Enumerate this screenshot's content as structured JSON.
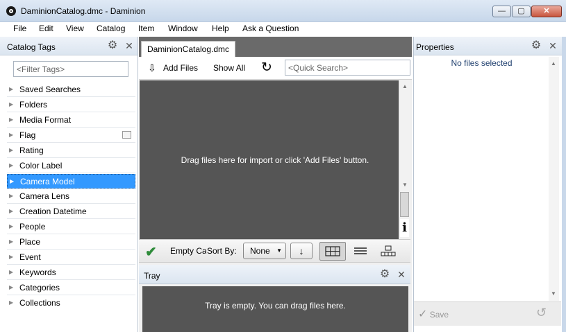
{
  "window": {
    "title": "DaminionCatalog.dmc - Daminion",
    "min_label": "—",
    "max_label": "▢",
    "close_label": "✕"
  },
  "menu": [
    "File",
    "Edit",
    "View",
    "Catalog",
    "Item",
    "Window",
    "Help",
    "Ask a Question"
  ],
  "catalog_panel": {
    "title": "Catalog Tags",
    "filter_placeholder": "<Filter Tags>",
    "tags": [
      "Saved Searches",
      "Folders",
      "Media Format",
      "Flag",
      "Rating",
      "Color Label",
      "Camera Model",
      "Camera Lens",
      "Creation Datetime",
      "People",
      "Place",
      "Event",
      "Keywords",
      "Categories",
      "Collections"
    ],
    "selected_tag": "Camera Model"
  },
  "center": {
    "tab_label": "DaminionCatalog.dmc",
    "add_files_label": "Add Files",
    "show_all_label": "Show All",
    "quick_search_placeholder": "<Quick Search>",
    "drop_message": "Drag files here for import or click 'Add Files' button.",
    "empty_catalog_label": "Empty Catalog",
    "sort_by_label": "Sort By:",
    "sort_value": "None"
  },
  "tray": {
    "title": "Tray",
    "message": "Tray is empty. You can drag files here."
  },
  "properties": {
    "title": "Properties",
    "empty_message": "No files selected",
    "save_label": "Save"
  },
  "colors": {
    "accent": "#3399ff",
    "dark_area": "#555555",
    "check": "#2e8b3a"
  }
}
